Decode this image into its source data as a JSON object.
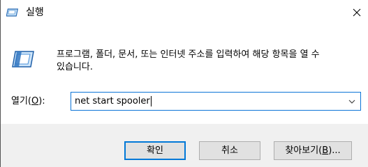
{
  "window": {
    "title": "실행",
    "title_icon": "run-dialog-icon",
    "close_glyph": "✕"
  },
  "content": {
    "description": "프로그램, 폴더, 문서, 또는 인터넷 주소를 입력하여 해당 항목을 열 수\n있습니다.",
    "open_label_prefix": "열기(",
    "open_label_key": "O",
    "open_label_suffix": "):",
    "command_value": "net start spooler",
    "dropdown_icon": "chevron-down-icon"
  },
  "buttons": {
    "ok_label": "확인",
    "cancel_label": "취소",
    "browse_label_prefix": "찾아보기(",
    "browse_label_key": "B",
    "browse_label_suffix": ")..."
  },
  "colors": {
    "accent": "#0078d7",
    "footer_bg": "#f0f0f0",
    "button_bg": "#e1e1e1"
  }
}
